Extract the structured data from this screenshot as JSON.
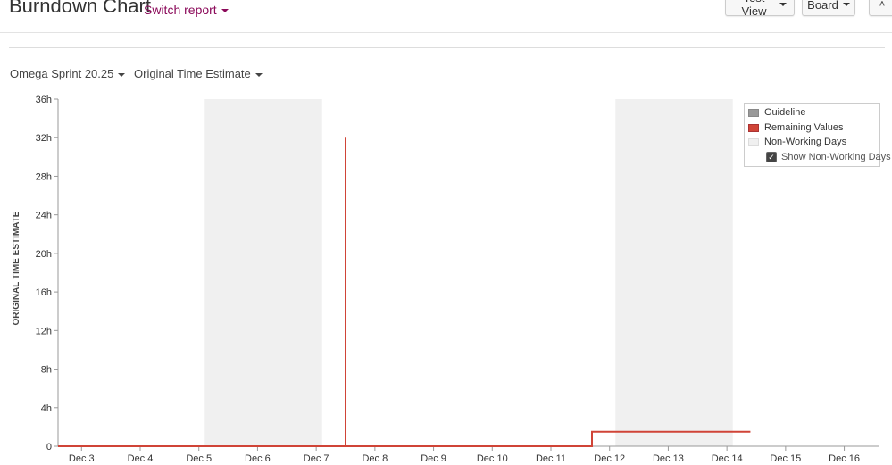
{
  "header": {
    "title": "Burndown Chart",
    "switch_report": "Switch report",
    "test_view": "Test View",
    "board": "Board",
    "collapse_glyph": "˄"
  },
  "filters": {
    "sprint": "Omega Sprint 20.25",
    "statistic": "Original Time Estimate"
  },
  "legend": {
    "guideline": "Guideline",
    "remaining": "Remaining Values",
    "non_working": "Non-Working Days",
    "show_non_working": "Show Non-Working Days",
    "show_non_working_checked": true
  },
  "colors": {
    "remaining": "#d04437",
    "non_working": "#f0f0f0",
    "link": "#8b0a5a"
  },
  "chart_data": {
    "type": "line",
    "ylabel": "ORIGINAL TIME ESTIMATE",
    "y_unit": "h",
    "ylim": [
      0,
      36
    ],
    "yticks": [
      0,
      4,
      8,
      12,
      16,
      20,
      24,
      28,
      32,
      36
    ],
    "y_tick_labels": [
      "0",
      "4h",
      "8h",
      "12h",
      "16h",
      "20h",
      "24h",
      "28h",
      "32h",
      "36h"
    ],
    "xlim": [
      2.6,
      16.6
    ],
    "xticks": [
      3,
      4,
      5,
      6,
      7,
      8,
      9,
      10,
      11,
      12,
      13,
      14,
      15,
      16
    ],
    "x_tick_labels": [
      "Dec 3",
      "Dec 4",
      "Dec 5",
      "Dec 6",
      "Dec 7",
      "Dec 8",
      "Dec 9",
      "Dec 10",
      "Dec 11",
      "Dec 12",
      "Dec 13",
      "Dec 14",
      "Dec 15",
      "Dec 16"
    ],
    "non_working_days": [
      {
        "start": 5.1,
        "end": 7.1
      },
      {
        "start": 12.1,
        "end": 14.1
      }
    ],
    "series": [
      {
        "name": "Remaining Values",
        "points": [
          [
            2.6,
            0
          ],
          [
            7.5,
            0
          ],
          [
            7.5,
            32
          ],
          [
            7.5,
            0
          ],
          [
            11.7,
            0
          ],
          [
            11.7,
            1.5
          ],
          [
            14.4,
            1.5
          ]
        ]
      }
    ]
  }
}
